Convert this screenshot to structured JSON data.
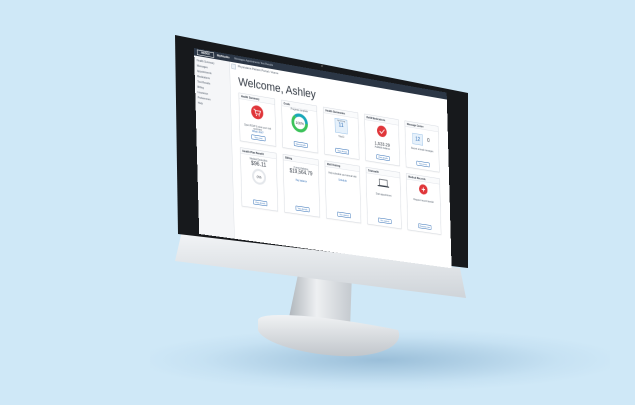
{
  "topbar": {
    "logo": "MEDEX",
    "app": "MyStudio",
    "nav": "Messages   Appointments   Test Results"
  },
  "sidebar": {
    "items": [
      "Health Summary",
      "Messages",
      "Appointments",
      "Medications",
      "Test Results",
      "Billing",
      "Insurance",
      "Preferences",
      "Help"
    ]
  },
  "breadcrumb": "Physicians Patient Portal  /  Home",
  "welcome": "Welcome, Ashley",
  "cards": [
    {
      "title": "Health Summary",
      "body": "Open RSVP & view your visit summary",
      "link": "What's this?",
      "button": "View now"
    },
    {
      "title": "Goals",
      "sub": "Progress complete",
      "value": "100%",
      "button": "View details"
    },
    {
      "title": "Health Summaries",
      "sub": "Upcoming",
      "value": "11",
      "note": "Total 2",
      "button": "View details"
    },
    {
      "title": "Refill Medications",
      "value": "1,533.29",
      "sub": "Available balance",
      "button": "View details"
    },
    {
      "title": "Message Center",
      "value": "12",
      "value2": "0",
      "sub": "Recent unread messages",
      "button": "View more"
    },
    {
      "title": "Health Plan Benefit",
      "sub": "Medical Deductible",
      "value": "$96.11",
      "gauge": "0%",
      "button": "View details"
    },
    {
      "title": "Billing",
      "sub": "Current balance",
      "value": "$19,564.79",
      "link": "Pay balance",
      "button": "View details"
    },
    {
      "title": "Well Visiting",
      "sub": "Help schedule your annual visit",
      "link": "Schedule",
      "button": "Get started"
    },
    {
      "title": "Telehealth",
      "sub": "Start appointment",
      "button": "Get started"
    },
    {
      "title": "Medical Records",
      "sub": "Request record transfer",
      "button": "Request now"
    }
  ],
  "colors": {
    "background": "#cfe8f7",
    "accent_red": "#e0363a",
    "accent_blue": "#2f6db5",
    "gauge_green": "#3cc25a",
    "gauge_teal": "#1aa7b8"
  }
}
